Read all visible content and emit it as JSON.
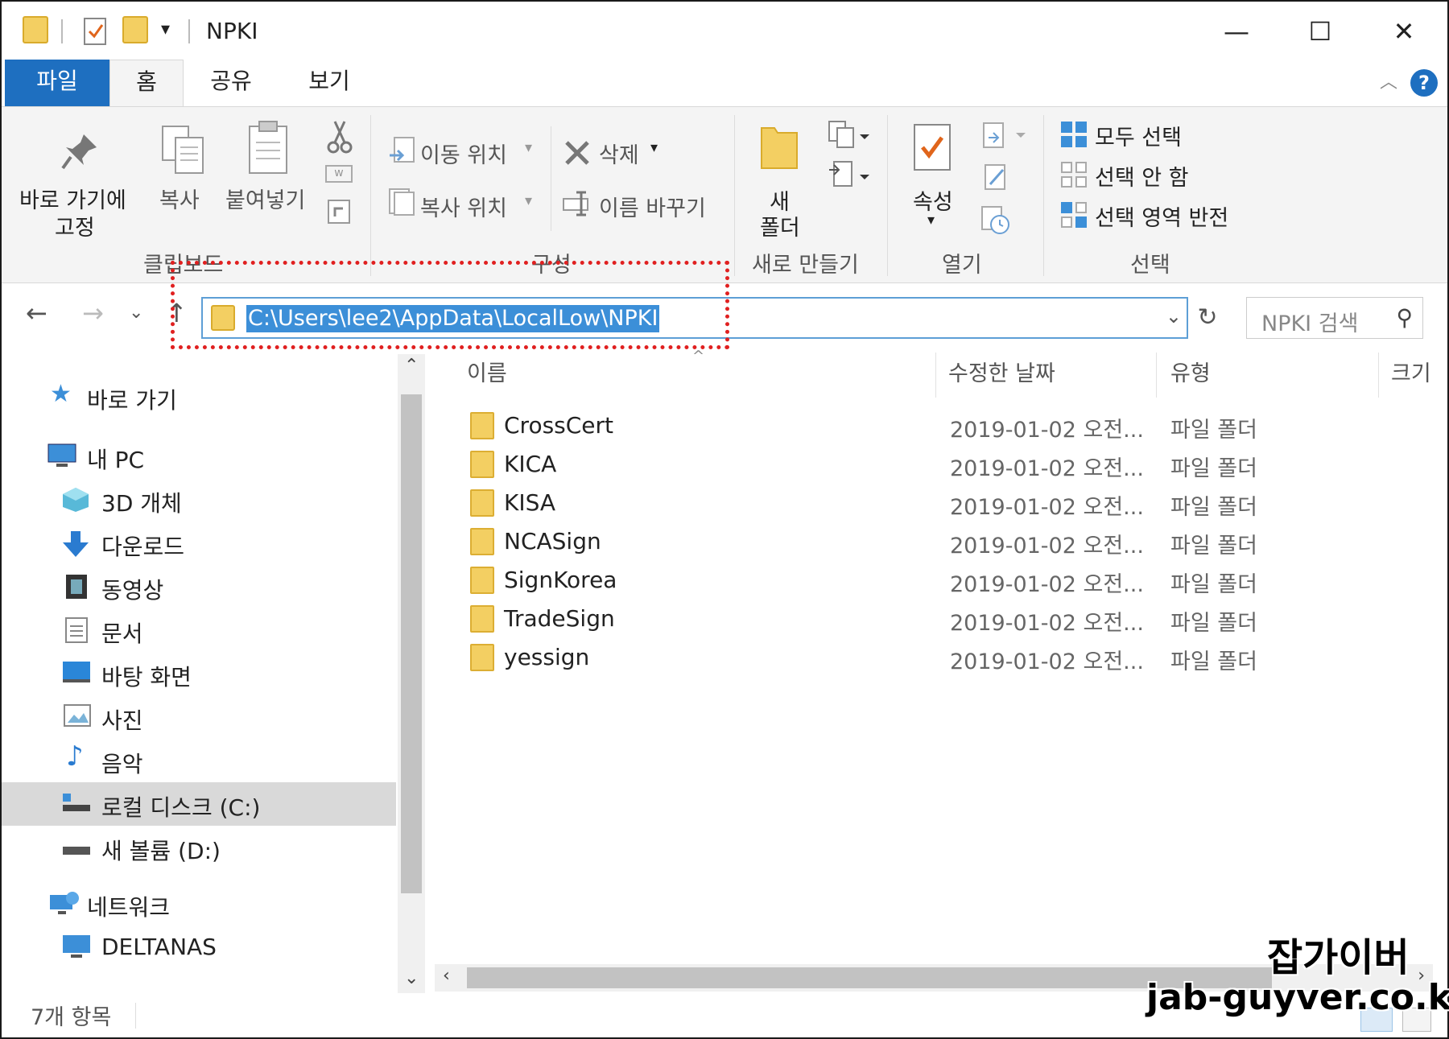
{
  "window": {
    "title": "NPKI",
    "minimize_glyph": "—",
    "maximize_glyph": "☐",
    "close_glyph": "✕"
  },
  "tabs": [
    {
      "label": "파일"
    },
    {
      "label": "홈"
    },
    {
      "label": "공유"
    },
    {
      "label": "보기"
    }
  ],
  "ribbon": {
    "clipboard": {
      "pin_label_1": "바로 가기에",
      "pin_label_2": "고정",
      "copy": "복사",
      "paste": "붙여넣기",
      "group": "클립보드"
    },
    "organize": {
      "move_to": "이동 위치",
      "copy_to": "복사 위치",
      "delete": "삭제",
      "rename": "이름 바꾸기",
      "group": "구성"
    },
    "new": {
      "new_folder_1": "새",
      "new_folder_2": "폴더",
      "group": "새로 만들기"
    },
    "open": {
      "properties": "속성",
      "group": "열기"
    },
    "select": {
      "select_all": "모두 선택",
      "select_none": "선택 안 함",
      "invert": "선택 영역 반전",
      "group": "선택"
    }
  },
  "address": {
    "path": "C:\\Users\\lee2\\AppData\\LocalLow\\NPKI",
    "search_placeholder": "NPKI 검색"
  },
  "nav": {
    "items": [
      {
        "label": "바로 가기",
        "icon": "star-icon"
      },
      {
        "label": "내 PC",
        "icon": "pc-icon"
      },
      {
        "label": "3D 개체",
        "icon": "cube-icon"
      },
      {
        "label": "다운로드",
        "icon": "download-icon"
      },
      {
        "label": "동영상",
        "icon": "video-icon"
      },
      {
        "label": "문서",
        "icon": "document-icon"
      },
      {
        "label": "바탕 화면",
        "icon": "desktop-icon"
      },
      {
        "label": "사진",
        "icon": "picture-icon"
      },
      {
        "label": "음악",
        "icon": "music-icon"
      },
      {
        "label": "로컬 디스크 (C:)",
        "icon": "disk-icon"
      },
      {
        "label": "새 볼륨 (D:)",
        "icon": "drive-icon"
      },
      {
        "label": "네트워크",
        "icon": "network-icon"
      },
      {
        "label": "DELTANAS",
        "icon": "computer-icon"
      }
    ]
  },
  "columns": {
    "name": "이름",
    "date": "수정한 날짜",
    "type": "유형",
    "size": "크기"
  },
  "files": [
    {
      "name": "CrossCert",
      "date": "2019-01-02 오전...",
      "type": "파일 폴더"
    },
    {
      "name": "KICA",
      "date": "2019-01-02 오전...",
      "type": "파일 폴더"
    },
    {
      "name": "KISA",
      "date": "2019-01-02 오전...",
      "type": "파일 폴더"
    },
    {
      "name": "NCASign",
      "date": "2019-01-02 오전...",
      "type": "파일 폴더"
    },
    {
      "name": "SignKorea",
      "date": "2019-01-02 오전...",
      "type": "파일 폴더"
    },
    {
      "name": "TradeSign",
      "date": "2019-01-02 오전...",
      "type": "파일 폴더"
    },
    {
      "name": "yessign",
      "date": "2019-01-02 오전...",
      "type": "파일 폴더"
    }
  ],
  "status": {
    "count": "7개 항목"
  },
  "watermark": {
    "line1": "잡가이버",
    "line2": "jab-guyver.co.kr"
  },
  "colors": {
    "accent": "#1e6fc0",
    "selection": "#3c8fd8",
    "highlight_border": "#e02020",
    "folder": "#f3cf62"
  }
}
